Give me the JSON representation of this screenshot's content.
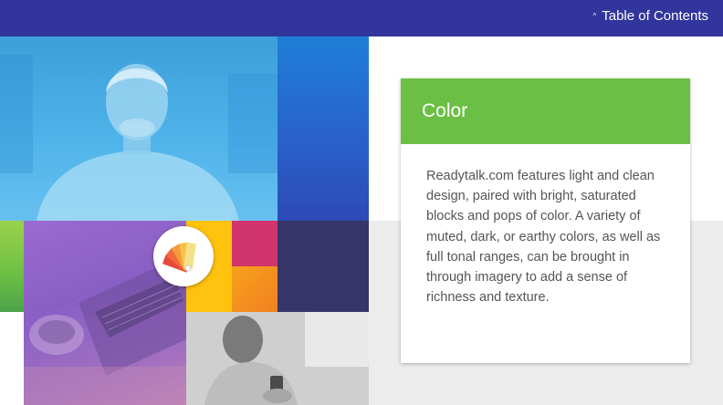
{
  "header": {
    "toc_label": "Table of Contents",
    "caret_glyph": "^"
  },
  "card": {
    "title": "Color",
    "body": "Readytalk.com features light and clean design, paired with bright, saturated blocks and pops of color. A variety of muted, dark, or earthy colors, as well as full tonal ranges, can be brought in through imagery to add a sense of richness and texture."
  },
  "icons": {
    "badge": "color-swatch-icon",
    "toc_caret": "caret-up-icon"
  },
  "colors": {
    "header_bar": "#32359b",
    "card_header": "#6cbf45",
    "body_text": "#555555",
    "yellow": "#ffc20e",
    "pink": "#d2346c",
    "orange": "#f27f22",
    "navy": "#363569",
    "blue": "#2a5fc8"
  }
}
